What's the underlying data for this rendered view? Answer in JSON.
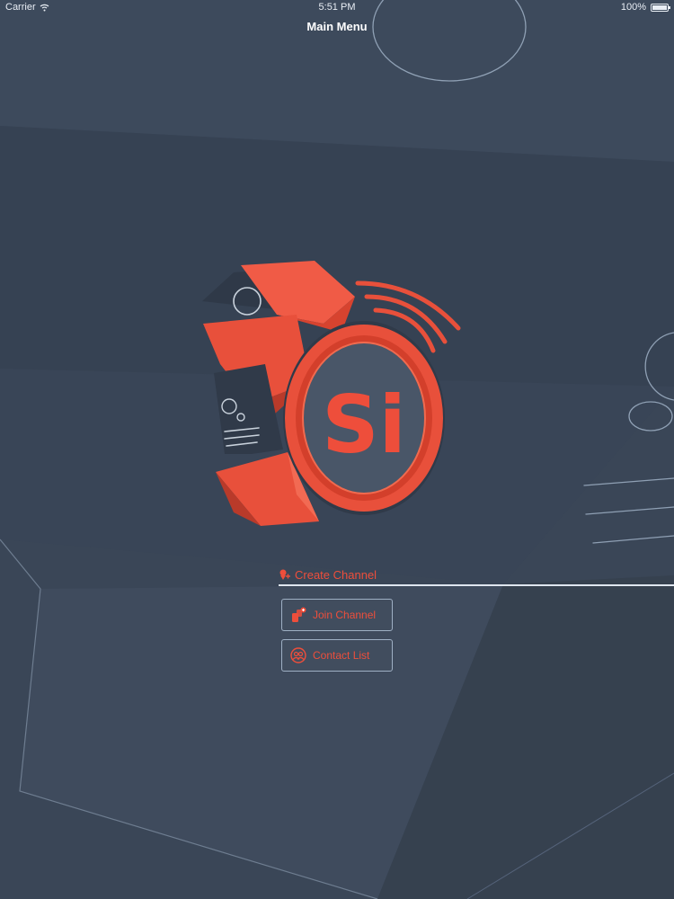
{
  "status_bar": {
    "carrier": "Carrier",
    "time": "5:51 PM",
    "battery": "100%",
    "battery_level": 1.0
  },
  "nav": {
    "title": "Main Menu"
  },
  "logo": {
    "text": "Si"
  },
  "menu": {
    "create_channel_label": "Create Channel",
    "join_channel_label": "Join Channel",
    "contact_list_label": "Contact List"
  },
  "colors": {
    "background": "#3a4657",
    "accent": "#ee4e3b",
    "outline": "#9fb0c4"
  },
  "icons": {
    "create_channel": "create-channel-icon",
    "join_channel": "join-channel-icon",
    "contact_list": "contact-list-icon",
    "wifi": "wifi-icon",
    "battery": "battery-icon"
  }
}
